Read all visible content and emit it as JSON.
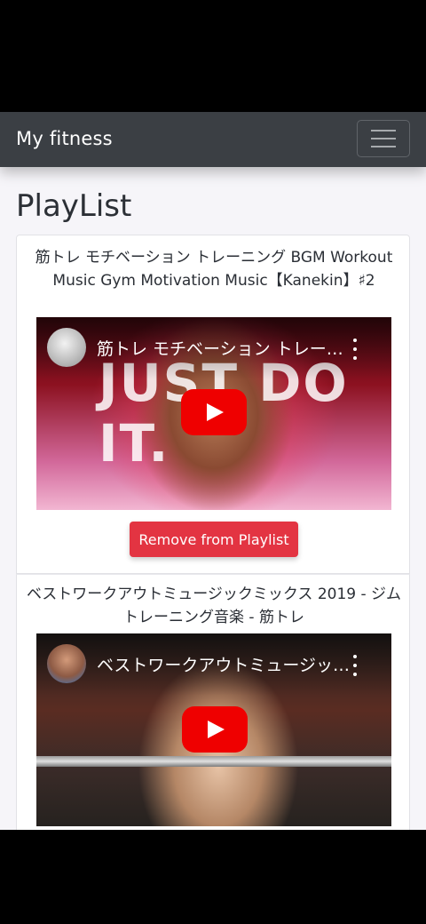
{
  "navbar": {
    "brand": "My fitness",
    "toggle_icon": "hamburger-menu-icon"
  },
  "page": {
    "title": "PlayList"
  },
  "playlist": [
    {
      "title": "筋トレ モチベーション トレーニング BGM Workout Music Gym Motivation Music【Kanekin】♯2",
      "embed_title": "筋トレ モチベーション トレーニング BGM Workout Music Gym Motivation Music【Kanekin】♯2",
      "thumbnail_text": "JUST DO IT.",
      "remove_label": "Remove from Playlist"
    },
    {
      "title": "ベストワークアウトミュージックミックス 2019 - ジムトレーニング音楽 - 筋トレ",
      "embed_title": "ベストワークアウトミュージックミックス 2019 - ジムトレーニング音楽 - 筋トレ"
    }
  ],
  "colors": {
    "navbar_bg": "#3b3f44",
    "remove_button": "#e33442",
    "youtube_play": "#ef0000"
  }
}
